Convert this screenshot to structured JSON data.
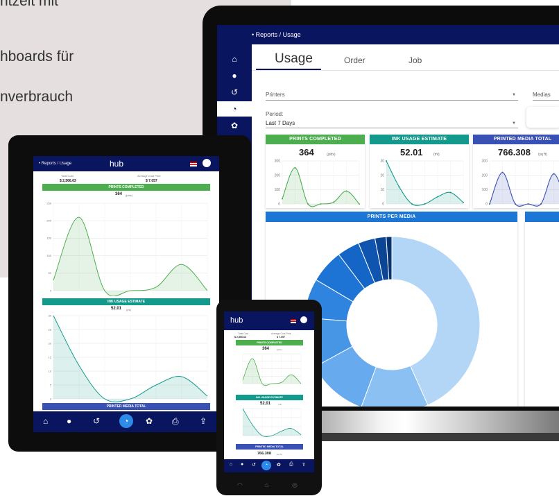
{
  "background": {
    "lines": [
      "ntzeit mit",
      "hboards für",
      "nverbrauch"
    ]
  },
  "monitor": {
    "breadcrumb": "Reports / Usage",
    "tabs": [
      {
        "label": "Usage",
        "active": true
      },
      {
        "label": "Order",
        "active": false
      },
      {
        "label": "Job",
        "active": false
      }
    ],
    "filters": {
      "printers_label": "Printers",
      "medias_label": "Medias",
      "period_label": "Period:",
      "period_value": "Last 7 Days"
    },
    "cards": [
      {
        "title": "PRINTS COMPLETED",
        "value": "364",
        "unit": "(jobs)",
        "color": "#4cae4f",
        "yticks": [
          "300",
          "200",
          "100",
          "0"
        ]
      },
      {
        "title": "INK USAGE ESTIMATE",
        "value": "52.01",
        "unit": "(ml)",
        "color": "#139a8c",
        "yticks": [
          "30",
          "20",
          "10",
          "0"
        ]
      },
      {
        "title": "PRINTED MEDIA TOTAL",
        "value": "766.308",
        "unit": "(sq ft)",
        "color": "#3950b5",
        "yticks": [
          "300",
          "200",
          "100",
          "0"
        ]
      }
    ],
    "panels": {
      "prints_per_media": "PRINTS PER MEDIA"
    }
  },
  "tablet": {
    "breadcrumb": "Reports / Usage",
    "brand": "hub",
    "total_cost_label": "Total Cost",
    "total_cost_value": "$ 2,566.63",
    "avg_cost_label": "Average Cost Print",
    "avg_cost_value": "$ 7.057",
    "prints_completed": {
      "title": "PRINTS COMPLETED",
      "value": "364",
      "unit": "(jobs)",
      "yticks": [
        "250",
        "200",
        "150",
        "100",
        "50",
        "0"
      ]
    },
    "ink_usage": {
      "title": "INK USAGE ESTIMATE",
      "value": "52.01",
      "unit": "(ml)",
      "yticks": [
        "30",
        "25",
        "20",
        "15",
        "10",
        "5",
        "0"
      ]
    },
    "printed_media": {
      "title": "PRINTED MEDIA TOTAL"
    }
  },
  "phone": {
    "brand": "hub",
    "total_cost_label": "Total Cost",
    "total_cost_value": "$ 2,566.63",
    "avg_cost_label": "Average Cost Print",
    "avg_cost_value": "$ 7.057",
    "prints_completed": {
      "title": "PRINTS COMPLETED",
      "value": "364",
      "unit": "(jobs)"
    },
    "ink_usage": {
      "title": "INK USAGE ESTIMATE",
      "value": "52.01",
      "unit": "(ml)"
    },
    "printed_media": {
      "title": "PRINTED MEDIA TOTAL",
      "value": "766.308",
      "unit": "(sq ft)"
    }
  },
  "chart_data": [
    {
      "type": "area",
      "title": "PRINTS COMPLETED",
      "x": [
        1,
        2,
        3,
        4,
        5,
        6,
        7
      ],
      "series": [
        {
          "values": [
            30,
            210,
            0,
            0,
            10,
            75,
            0
          ]
        }
      ],
      "ylim": [
        0,
        250
      ]
    },
    {
      "type": "area",
      "title": "INK USAGE ESTIMATE",
      "x": [
        1,
        2,
        3,
        4,
        5,
        6,
        7
      ],
      "series": [
        {
          "values": [
            30,
            12,
            0,
            0,
            5,
            8,
            1
          ]
        }
      ],
      "ylim": [
        0,
        30
      ]
    },
    {
      "type": "area",
      "title": "PRINTED MEDIA TOTAL",
      "x": [
        1,
        2,
        3,
        4,
        5,
        6,
        7
      ],
      "series": [
        {
          "values": [
            0,
            220,
            0,
            0,
            0,
            210,
            0
          ]
        }
      ],
      "ylim": [
        0,
        300
      ]
    },
    {
      "type": "pie",
      "title": "PRINTS PER MEDIA",
      "values": [
        42,
        12,
        11,
        9,
        7,
        6,
        4,
        3,
        2,
        1
      ],
      "colors": [
        "#b3d6f6",
        "#8bc1f2",
        "#67aaed",
        "#4796e6",
        "#2e84df",
        "#1d74d5",
        "#1565c6",
        "#0f55b0",
        "#0b4593",
        "#083270"
      ]
    }
  ]
}
